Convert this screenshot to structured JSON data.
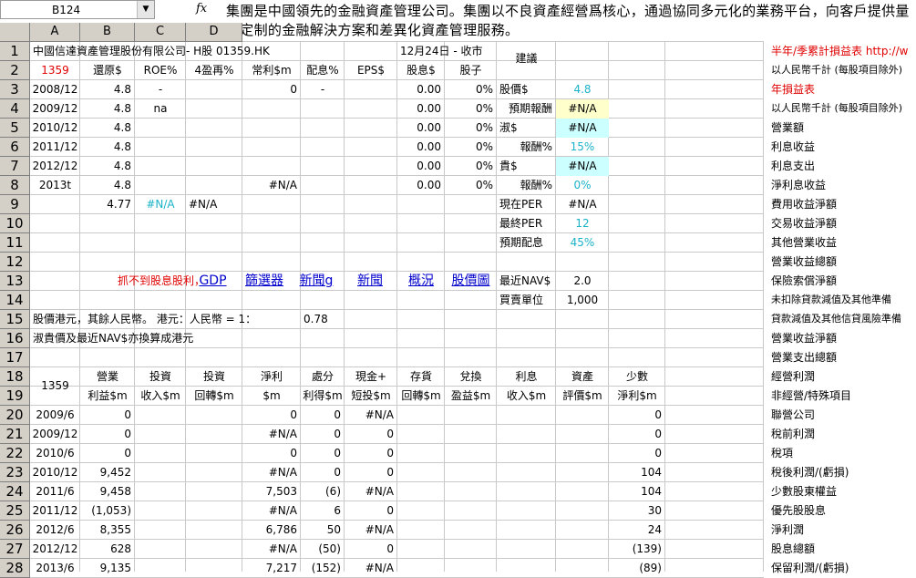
{
  "app": {
    "name_box": "B124",
    "fx_symbol": "fx",
    "formula_text": "集團是中國領先的金融資產管理公司。集團以不良資產經營爲核心，通過協同多元化的業務平台，向客戶提供量身定制的金融解決方案和差異化資產管理服務。"
  },
  "columns": [
    "A",
    "B",
    "C",
    "D"
  ],
  "rows": [
    "1",
    "2",
    "3",
    "4",
    "5",
    "6",
    "7",
    "8",
    "9",
    "10",
    "11",
    "12",
    "13",
    "14",
    "15",
    "16",
    "17",
    "18",
    "19",
    "20",
    "21",
    "22",
    "23",
    "24",
    "25",
    "26",
    "27",
    "28"
  ],
  "header": {
    "company": "中國信達資產管理股份有限公司- H股   01359.HK",
    "date": "12月24日 - 收市",
    "suggest": "建議",
    "code": "1359",
    "cols": [
      "還原$",
      "ROE%",
      "4盈再%",
      "常利$m",
      "配息%",
      "EPS$",
      "股息$",
      "股子"
    ]
  },
  "history": [
    {
      "year": "2008/12",
      "v1": "4.8",
      "v2": "-",
      "v3": "",
      "v4": "0",
      "v5": "-",
      "v6": "",
      "v7": "0.00",
      "v8": "0%"
    },
    {
      "year": "2009/12",
      "v1": "4.8",
      "v2": "na",
      "v3": "",
      "v4": "",
      "v5": "",
      "v6": "",
      "v7": "0.00",
      "v8": "0%"
    },
    {
      "year": "2010/12",
      "v1": "4.8",
      "v2": "",
      "v3": "",
      "v4": "",
      "v5": "",
      "v6": "",
      "v7": "0.00",
      "v8": "0%"
    },
    {
      "year": "2011/12",
      "v1": "4.8",
      "v2": "",
      "v3": "",
      "v4": "",
      "v5": "",
      "v6": "",
      "v7": "0.00",
      "v8": "0%"
    },
    {
      "year": "2012/12",
      "v1": "4.8",
      "v2": "",
      "v3": "",
      "v4": "",
      "v5": "",
      "v6": "",
      "v7": "0.00",
      "v8": "0%"
    },
    {
      "year": "2013t",
      "v1": "4.8",
      "v2": "",
      "v3": "",
      "v4": "#N/A",
      "v5": "",
      "v6": "",
      "v7": "0.00",
      "v8": "0%"
    }
  ],
  "row9": {
    "b": "4.77",
    "c": "#N/A",
    "d": "#N/A"
  },
  "side": [
    {
      "label": "股價$",
      "value": "4.8"
    },
    {
      "label": "預期報酬",
      "value": "#N/A"
    },
    {
      "label": "淑$",
      "value": "#N/A"
    },
    {
      "label": "報酬%",
      "value": "15%"
    },
    {
      "label": "貴$",
      "value": "#N/A"
    },
    {
      "label": "報酬%",
      "value": "0%"
    },
    {
      "label": "現在PER",
      "value": "#N/A"
    },
    {
      "label": "最終PER",
      "value": "12"
    },
    {
      "label": "預期配息",
      "value": "45%"
    },
    {
      "label": "最近NAV$",
      "value": "2.0"
    },
    {
      "label": "買賣單位",
      "value": "1,000"
    }
  ],
  "links": {
    "warn": "抓不到股息股利，",
    "items": [
      "GDP",
      "篩選器",
      "新聞g",
      "新聞",
      "概況",
      "股價圖"
    ]
  },
  "notes": {
    "r15a": "股價港元，其餘人民幣。  港元：人民幣 = 1：",
    "r15b": "0.78",
    "r16": "淑貴價及最近NAV$亦換算成港元"
  },
  "table": {
    "code": "1359",
    "head1": [
      "營業",
      "投資",
      "投資",
      "淨利",
      "處分",
      "現金+",
      "存貨",
      "兌換",
      "利息",
      "資產",
      "少數"
    ],
    "head2": [
      "利益$m",
      "收入$m",
      "回轉$m",
      "$m",
      "利得$m",
      "短投$m",
      "回轉$m",
      "盈益$m",
      "收入$m",
      "評價$m",
      "淨利$m"
    ],
    "rows": [
      {
        "year": "2009/6",
        "c": [
          "0",
          "",
          "",
          "0",
          "0",
          "#N/A",
          "",
          "",
          "",
          "",
          "0"
        ]
      },
      {
        "year": "2009/12",
        "c": [
          "0",
          "",
          "",
          "#N/A",
          "0",
          "0",
          "",
          "",
          "",
          "",
          "0"
        ]
      },
      {
        "year": "2010/6",
        "c": [
          "0",
          "",
          "",
          "0",
          "0",
          "0",
          "",
          "",
          "",
          "",
          "0"
        ]
      },
      {
        "year": "2010/12",
        "c": [
          "9,452",
          "",
          "",
          "#N/A",
          "0",
          "0",
          "",
          "",
          "",
          "",
          "104"
        ]
      },
      {
        "year": "2011/6",
        "c": [
          "9,458",
          "",
          "",
          "7,503",
          "(6)",
          "#N/A",
          "",
          "",
          "",
          "",
          "104"
        ]
      },
      {
        "year": "2011/12",
        "c": [
          "(1,053)",
          "",
          "",
          "#N/A",
          "6",
          "0",
          "",
          "",
          "",
          "",
          "30"
        ]
      },
      {
        "year": "2012/6",
        "c": [
          "8,355",
          "",
          "",
          "6,786",
          "50",
          "#N/A",
          "",
          "",
          "",
          "",
          "24"
        ]
      },
      {
        "year": "2012/12",
        "c": [
          "628",
          "",
          "",
          "#N/A",
          "(50)",
          "0",
          "",
          "",
          "",
          "",
          "(139)"
        ]
      },
      {
        "year": "2013/6",
        "c": [
          "9,135",
          "",
          "",
          "7,217",
          "(152)",
          "#N/A",
          "",
          "",
          "",
          "",
          "(89)"
        ]
      }
    ]
  },
  "right_panel": [
    "半年/季累計損益表  http://w",
    "以人民幣千計 (每股項目除外)",
    "年損益表",
    "以人民幣千計 (每股項目除外)",
    "營業額",
    "利息收益",
    "利息支出",
    "淨利息收益",
    "費用收益淨額",
    "交易收益淨額",
    "其他營業收益",
    "營業收益總額",
    "保險索償淨額",
    "未扣除貸款減值及其他準備",
    "貸款減值及其他信貸風險準備",
    "營業收益淨額",
    "營業支出總額",
    "經營利潤",
    "非經營/特殊項目",
    "聯營公司",
    "稅前利潤",
    "稅項",
    "稅後利潤/(虧損)",
    "少數股東權益",
    "優先股股息",
    "淨利潤",
    "股息總額",
    "保留利潤/(虧損)"
  ],
  "colors": {
    "red": "#e00000",
    "cyan": "#1ab3c8",
    "link": "#0000cc",
    "yellow_cell": "#ffffcc",
    "blue_cell": "#ccffff"
  }
}
